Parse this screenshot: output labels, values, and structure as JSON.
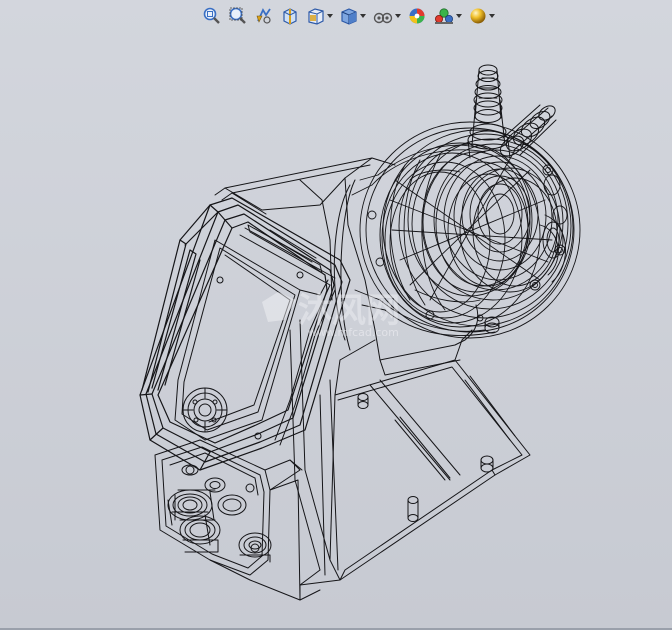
{
  "toolbar": {
    "items": [
      {
        "icon": "zoom-to-fit-icon"
      },
      {
        "icon": "zoom-to-area-icon"
      },
      {
        "icon": "previous-view-icon"
      },
      {
        "icon": "section-view-icon"
      },
      {
        "icon": "view-orientation-icon",
        "dropdown": true
      },
      {
        "icon": "display-style-icon",
        "dropdown": true
      },
      {
        "icon": "hide-show-items-icon",
        "dropdown": true
      },
      {
        "icon": "edit-appearance-icon"
      },
      {
        "icon": "apply-scene-icon",
        "dropdown": true
      },
      {
        "icon": "view-settings-icon",
        "dropdown": true
      }
    ]
  },
  "colors": {
    "background": "#c9ccd4",
    "wire": "#151518",
    "icon_blue": "#3a6fc4",
    "icon_gold": "#d9a11a"
  },
  "watermark": {
    "text": "沐风网",
    "url": "www.mfcad.com"
  }
}
